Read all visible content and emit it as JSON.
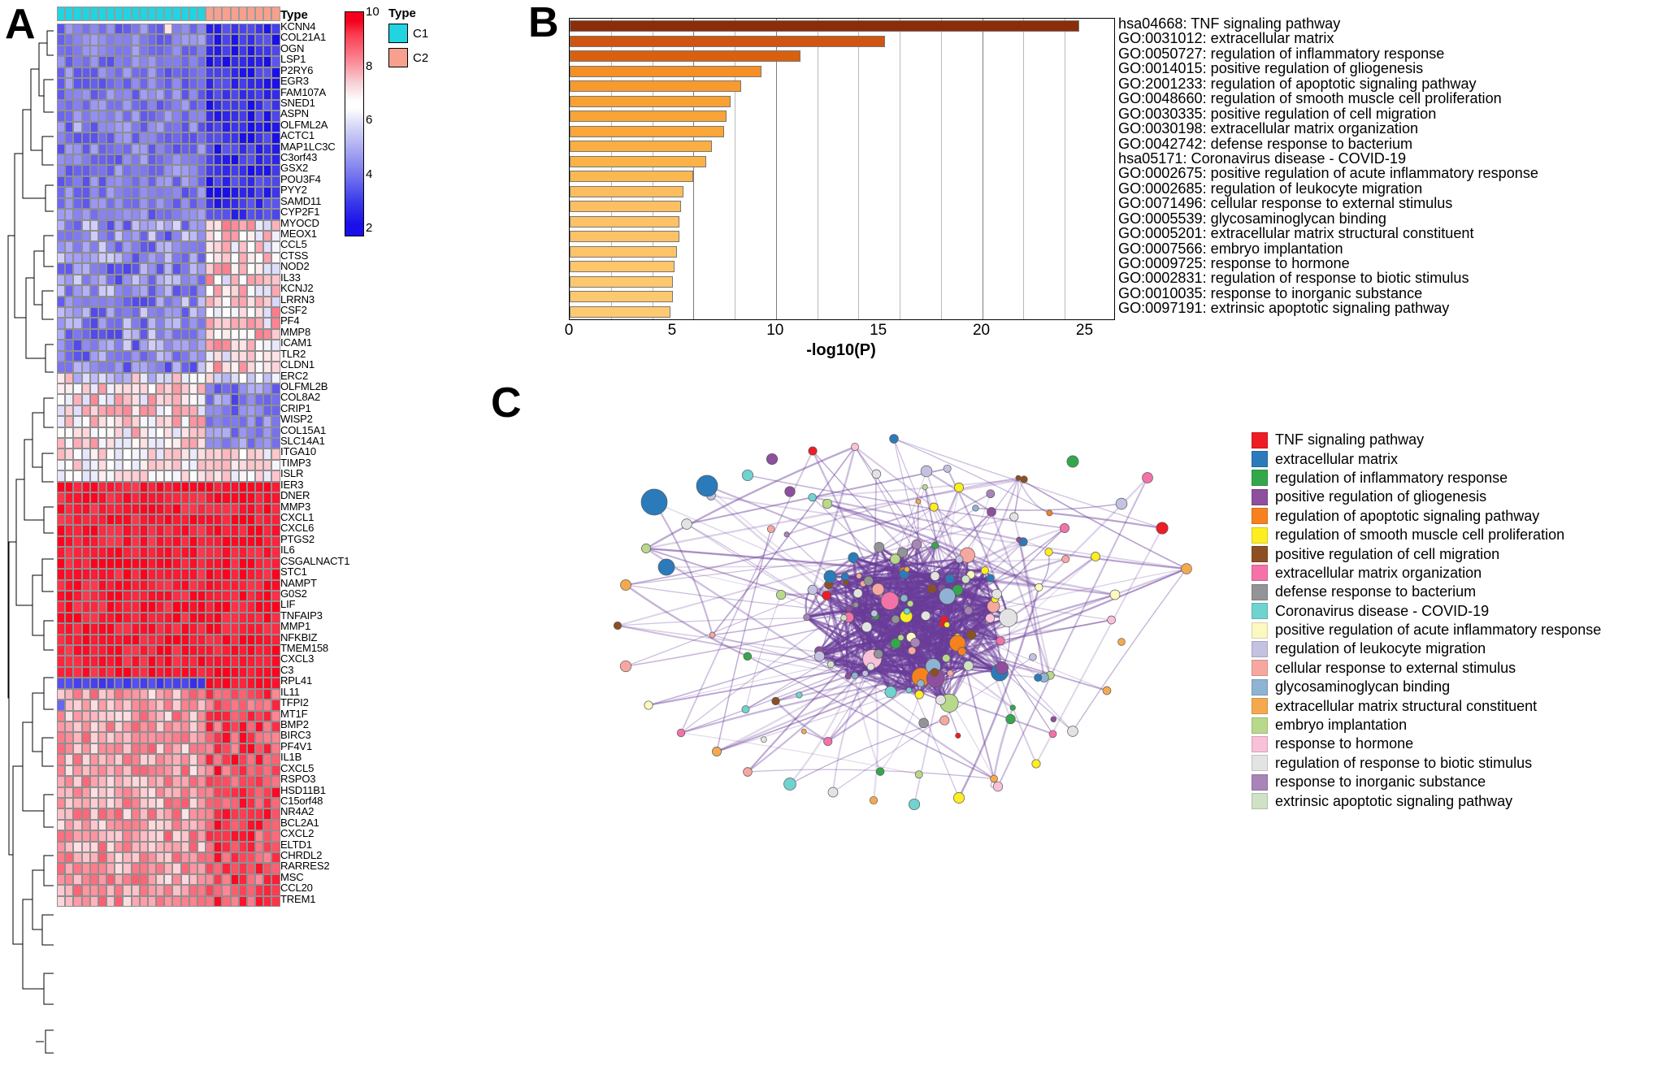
{
  "panels": {
    "a": {
      "letter": "A"
    },
    "b": {
      "letter": "B"
    },
    "c": {
      "letter": "C"
    }
  },
  "heatmap": {
    "type_title": "Type",
    "colorbar": {
      "ticks": [
        "10",
        "8",
        "6",
        "4",
        "2"
      ],
      "min": 1,
      "max": 10,
      "high_color": "#f5001d",
      "mid_color": "#ffffff",
      "low_color": "#1a0fe8"
    },
    "type_legend": {
      "title": "Type",
      "items": [
        {
          "label": "C1",
          "color": "#22d3e0"
        },
        {
          "label": "C2",
          "color": "#f7a08e"
        }
      ]
    },
    "n_c1_columns": 18,
    "n_c2_columns": 9,
    "genes": [
      "KCNN4",
      "COL21A1",
      "OGN",
      "LSP1",
      "P2RY6",
      "EGR3",
      "FAM107A",
      "SNED1",
      "ASPN",
      "OLFML2A",
      "ACTC1",
      "MAP1LC3C",
      "C3orf43",
      "GSX2",
      "POU3F4",
      "PYY2",
      "SAMD11",
      "CYP2F1",
      "MYOCD",
      "MEOX1",
      "CCL5",
      "CTSS",
      "NOD2",
      "IL33",
      "KCNJ2",
      "LRRN3",
      "CSF2",
      "PF4",
      "MMP8",
      "ICAM1",
      "TLR2",
      "CLDN1",
      "ERC2",
      "OLFML2B",
      "COL8A2",
      "CRIP1",
      "WISP2",
      "COL15A1",
      "SLC14A1",
      "ITGA10",
      "TIMP3",
      "ISLR",
      "IER3",
      "DNER",
      "MMP3",
      "CXCL1",
      "CXCL6",
      "PTGS2",
      "IL6",
      "CSGALNACT1",
      "STC1",
      "NAMPT",
      "G0S2",
      "LIF",
      "TNFAIP3",
      "MMP1",
      "NFKBIZ",
      "TMEM158",
      "CXCL3",
      "C3",
      "RPL41",
      "IL11",
      "TFPI2",
      "MT1F",
      "BMP2",
      "BIRC3",
      "PF4V1",
      "IL1B",
      "CXCL5",
      "RSPO3",
      "HSD11B1",
      "C15orf48",
      "NR4A2",
      "BCL2A1",
      "CXCL2",
      "ELTD1",
      "CHRDL2",
      "RARRES2",
      "MSC",
      "CCL20",
      "TREM1"
    ]
  },
  "chart_data": {
    "type": "bar",
    "title": "",
    "xlabel": "-log10(P)",
    "ylabel": "",
    "xlim": [
      0,
      26.4
    ],
    "grid": true,
    "orientation": "horizontal",
    "xticks": [
      0,
      5,
      10,
      15,
      20,
      25
    ],
    "gridlines_minor": [
      2,
      4,
      6,
      8,
      12,
      14,
      16,
      18,
      22,
      24
    ],
    "categories": [
      "hsa04668: TNF signaling pathway",
      "GO:0031012: extracellular matrix",
      "GO:0050727: regulation of inflammatory response",
      "GO:0014015: positive regulation of gliogenesis",
      "GO:2001233: regulation of apoptotic signaling pathway",
      "GO:0048660: regulation of smooth muscle cell proliferation",
      "GO:0030335: positive regulation of cell migration",
      "GO:0030198: extracellular matrix organization",
      "GO:0042742: defense response to bacterium",
      "hsa05171: Coronavirus disease - COVID-19",
      "GO:0002675: positive regulation of acute inflammatory response",
      "GO:0002685: regulation of leukocyte migration",
      "GO:0071496: cellular response to external stimulus",
      "GO:0005539: glycosaminoglycan binding",
      "GO:0005201: extracellular matrix structural constituent",
      "GO:0007566: embryo implantation",
      "GO:0009725: response to hormone",
      "GO:0002831: regulation of response to biotic stimulus",
      "GO:0010035: response to inorganic substance",
      "GO:0097191: extrinsic apoptotic signaling pathway"
    ],
    "values": [
      24.7,
      15.3,
      11.2,
      9.3,
      8.3,
      7.8,
      7.6,
      7.5,
      6.9,
      6.6,
      6.0,
      5.5,
      5.4,
      5.3,
      5.3,
      5.2,
      5.1,
      5.0,
      5.0,
      4.9
    ],
    "bar_colors": [
      "#8c2d0a",
      "#cf5510",
      "#d9600f",
      "#f59026",
      "#f89a2d",
      "#f9a132",
      "#f9a436",
      "#faa638",
      "#fbae41",
      "#fbb247",
      "#fcb850",
      "#fcbe5c",
      "#fcc062",
      "#fdc265",
      "#fdc265",
      "#fdc468",
      "#fdc66b",
      "#fdc86e",
      "#fdc86e",
      "#fdca72"
    ]
  },
  "network_legend": {
    "items": [
      {
        "label": "TNF signaling pathway",
        "color": "#ee1c25"
      },
      {
        "label": "extracellular matrix",
        "color": "#2b7bba"
      },
      {
        "label": "regulation of inflammatory response",
        "color": "#33a84b"
      },
      {
        "label": "positive regulation of gliogenesis",
        "color": "#8d4f9e"
      },
      {
        "label": "regulation of apoptotic signaling pathway",
        "color": "#f5821f"
      },
      {
        "label": "regulation of smooth muscle cell proliferation",
        "color": "#fcee21"
      },
      {
        "label": "positive regulation of cell migration",
        "color": "#8c5022"
      },
      {
        "label": "extracellular matrix organization",
        "color": "#f472a8"
      },
      {
        "label": "defense response to bacterium",
        "color": "#929497"
      },
      {
        "label": "Coronavirus disease - COVID-19",
        "color": "#6fd3cf"
      },
      {
        "label": "positive regulation of acute inflammatory response",
        "color": "#fbf8c0"
      },
      {
        "label": "regulation of leukocyte migration",
        "color": "#c3c2e2"
      },
      {
        "label": "cellular response to external stimulus",
        "color": "#f6a8a0"
      },
      {
        "label": "glycosaminoglycan binding",
        "color": "#8fb3d3"
      },
      {
        "label": "extracellular matrix structural constituent",
        "color": "#f5a94e"
      },
      {
        "label": "embryo implantation",
        "color": "#b9d98a"
      },
      {
        "label": "response to hormone",
        "color": "#f9c0da"
      },
      {
        "label": "regulation of response to biotic stimulus",
        "color": "#e3e3e3"
      },
      {
        "label": "response to inorganic substance",
        "color": "#a884b8"
      },
      {
        "label": "extrinsic apoptotic signaling pathway",
        "color": "#cfe2c6"
      }
    ]
  }
}
